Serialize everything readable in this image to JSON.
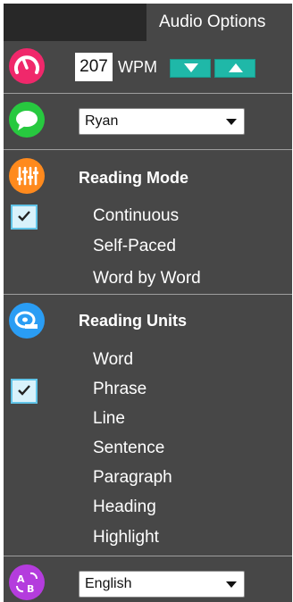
{
  "tabs": {
    "active_label": "Audio Options"
  },
  "speed": {
    "wpm_value": "207",
    "wpm_label": "WPM"
  },
  "voice": {
    "selected": "Ryan"
  },
  "reading_mode": {
    "title": "Reading Mode",
    "options": [
      "Continuous",
      "Self-Paced",
      "Word by Word"
    ],
    "checked": "Continuous"
  },
  "reading_units": {
    "title": "Reading Units",
    "options": [
      "Word",
      "Phrase",
      "Line",
      "Sentence",
      "Paragraph",
      "Heading",
      "Highlight"
    ],
    "checked": "Phrase"
  },
  "language": {
    "selected": "English"
  },
  "colors": {
    "speed_icon": "#f0286b",
    "voice_icon": "#27c93f",
    "mode_icon": "#ff8a1d",
    "units_icon": "#2a9df4",
    "language_icon": "#b43cdd",
    "stepper": "#1fb8a8",
    "checkbox_fill": "#d9f2fb"
  }
}
